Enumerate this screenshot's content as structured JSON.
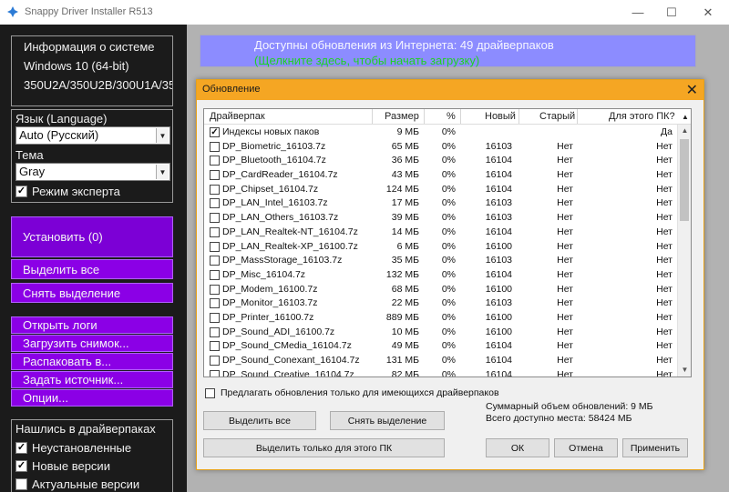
{
  "window": {
    "title": "Snappy Driver Installer R513",
    "minimize": "—",
    "maximize": "☐",
    "close": "✕"
  },
  "left": {
    "sysinfo": [
      "Информация о системе",
      "Windows 10 (64-bit)",
      "350U2A/350U2B/300U1A/35"
    ],
    "language_label": "Язык (Language)",
    "language_value": "Auto (Русский)",
    "theme_label": "Тема",
    "theme_value": "Gray",
    "expert_mode": "Режим эксперта",
    "buttons": {
      "install": "Установить (0)",
      "select_all": "Выделить все",
      "deselect": "Снять выделение",
      "open_logs": "Открыть логи",
      "load_snapshot": "Загрузить снимок...",
      "extract": "Распаковать в...",
      "set_source": "Задать источник...",
      "options": "Опции..."
    },
    "found_title": "Нашлись в драйверпаках",
    "filters": [
      "Неустановленные",
      "Новые версии",
      "Актуальные версии"
    ]
  },
  "banner": {
    "line1": "Доступны обновления из Интернета: 49 драйверпаков",
    "line2": "(Щелкните здесь, чтобы начать загрузку)"
  },
  "dialog": {
    "title": "Обновление",
    "close": "✕",
    "columns": [
      "Драйверпак",
      "Размер",
      "%",
      "Новый",
      "Старый",
      "Для этого ПК?"
    ],
    "rows": [
      {
        "checked": true,
        "name": "Индексы новых паков",
        "size": "9 МБ",
        "pct": "0%",
        "new": "",
        "old": "",
        "pc": "Да"
      },
      {
        "checked": false,
        "name": "DP_Biometric_16103.7z",
        "size": "65 МБ",
        "pct": "0%",
        "new": "16103",
        "old": "Нет",
        "pc": "Нет"
      },
      {
        "checked": false,
        "name": "DP_Bluetooth_16104.7z",
        "size": "36 МБ",
        "pct": "0%",
        "new": "16104",
        "old": "Нет",
        "pc": "Нет"
      },
      {
        "checked": false,
        "name": "DP_CardReader_16104.7z",
        "size": "43 МБ",
        "pct": "0%",
        "new": "16104",
        "old": "Нет",
        "pc": "Нет"
      },
      {
        "checked": false,
        "name": "DP_Chipset_16104.7z",
        "size": "124 МБ",
        "pct": "0%",
        "new": "16104",
        "old": "Нет",
        "pc": "Нет"
      },
      {
        "checked": false,
        "name": "DP_LAN_Intel_16103.7z",
        "size": "17 МБ",
        "pct": "0%",
        "new": "16103",
        "old": "Нет",
        "pc": "Нет"
      },
      {
        "checked": false,
        "name": "DP_LAN_Others_16103.7z",
        "size": "39 МБ",
        "pct": "0%",
        "new": "16103",
        "old": "Нет",
        "pc": "Нет"
      },
      {
        "checked": false,
        "name": "DP_LAN_Realtek-NT_16104.7z",
        "size": "14 МБ",
        "pct": "0%",
        "new": "16104",
        "old": "Нет",
        "pc": "Нет"
      },
      {
        "checked": false,
        "name": "DP_LAN_Realtek-XP_16100.7z",
        "size": "6 МБ",
        "pct": "0%",
        "new": "16100",
        "old": "Нет",
        "pc": "Нет"
      },
      {
        "checked": false,
        "name": "DP_MassStorage_16103.7z",
        "size": "35 МБ",
        "pct": "0%",
        "new": "16103",
        "old": "Нет",
        "pc": "Нет"
      },
      {
        "checked": false,
        "name": "DP_Misc_16104.7z",
        "size": "132 МБ",
        "pct": "0%",
        "new": "16104",
        "old": "Нет",
        "pc": "Нет"
      },
      {
        "checked": false,
        "name": "DP_Modem_16100.7z",
        "size": "68 МБ",
        "pct": "0%",
        "new": "16100",
        "old": "Нет",
        "pc": "Нет"
      },
      {
        "checked": false,
        "name": "DP_Monitor_16103.7z",
        "size": "22 МБ",
        "pct": "0%",
        "new": "16103",
        "old": "Нет",
        "pc": "Нет"
      },
      {
        "checked": false,
        "name": "DP_Printer_16100.7z",
        "size": "889 МБ",
        "pct": "0%",
        "new": "16100",
        "old": "Нет",
        "pc": "Нет"
      },
      {
        "checked": false,
        "name": "DP_Sound_ADI_16100.7z",
        "size": "10 МБ",
        "pct": "0%",
        "new": "16100",
        "old": "Нет",
        "pc": "Нет"
      },
      {
        "checked": false,
        "name": "DP_Sound_CMedia_16104.7z",
        "size": "49 МБ",
        "pct": "0%",
        "new": "16104",
        "old": "Нет",
        "pc": "Нет"
      },
      {
        "checked": false,
        "name": "DP_Sound_Conexant_16104.7z",
        "size": "131 МБ",
        "pct": "0%",
        "new": "16104",
        "old": "Нет",
        "pc": "Нет"
      },
      {
        "checked": false,
        "name": "DP_Sound_Creative_16104.7z",
        "size": "82 МБ",
        "pct": "0%",
        "new": "16104",
        "old": "Нет",
        "pc": "Нет"
      }
    ],
    "offer_only_existing": "Предлагать обновления только для имеющихся драйверпаков",
    "select_all": "Выделить все",
    "deselect": "Снять выделение",
    "select_for_pc": "Выделить только для этого ПК",
    "summary_total": "Суммарный объем обновлений: 9 МБ",
    "summary_free": "Всего доступно места: 58424 МБ",
    "ok": "ОК",
    "cancel": "Отмена",
    "apply": "Применить"
  },
  "colors": {
    "purple_button": "#8b00e6",
    "banner": "#8c8cff",
    "banner_link": "#1fd31f",
    "dialog_title": "#f5a623"
  }
}
